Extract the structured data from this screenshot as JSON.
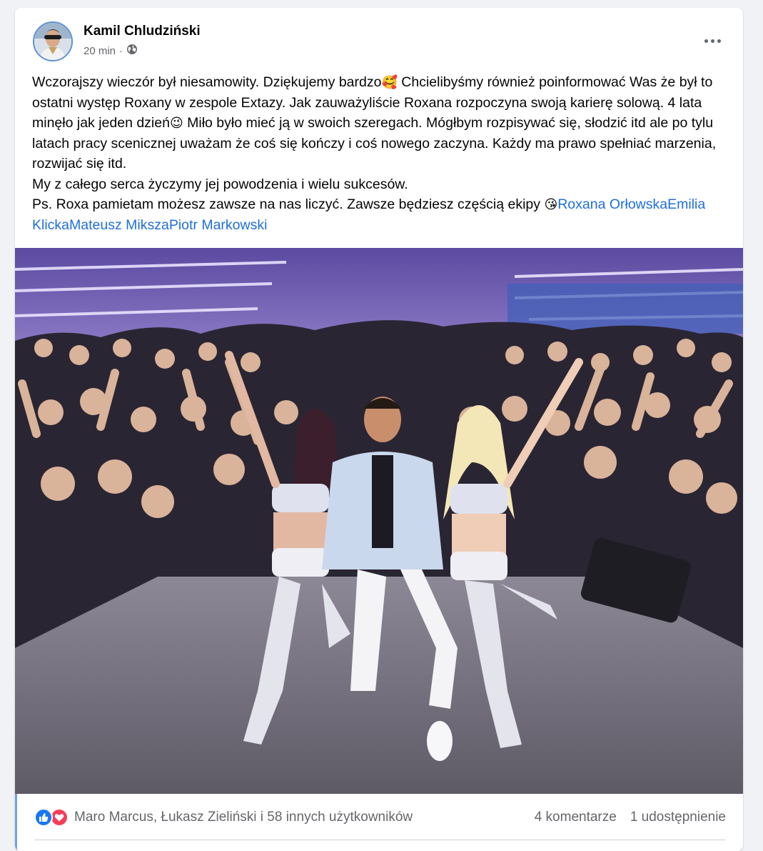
{
  "post": {
    "author": "Kamil Chludziński",
    "time": "20 min",
    "separator": "·",
    "audience_icon": "globe-icon",
    "more_icon": "more-dots-icon",
    "text": {
      "p1_a": "Wczorajszy wieczór był niesamowity. Dziękujemy bardzo",
      "emoji1": "🥰",
      "p1_b": " Chcielibyśmy również poinformować Was że był to ostatni występ Roxany w zespole Extazy. Jak zauważyliście Roxana rozpoczyna swoją karierę solową. 4 lata minęło jak jeden dzień",
      "emoji2": "😉",
      "p1_c": " Miło było mieć ją w swoich szeregach. Mógłbym rozpisywać się, słodzić itd ale po tylu latach pracy scenicznej uważam że coś się kończy i coś nowego zaczyna. Każdy ma prawo spełniać marzenia, rozwijać się itd.",
      "p2": "My z całego serca życzymy jej powodzenia i wielu sukcesów.",
      "p3": "Ps. Roxa pamietam możesz zawsze na nas liczyć. Zawsze będziesz częścią ekipy ",
      "emoji3": "😘",
      "mentions": [
        "Roxana Orłowska",
        "Emilia Klicka",
        "Mateusz Miksza",
        "Piotr Markowski"
      ]
    },
    "photo": {
      "alt": "group-photo",
      "colors": {
        "wall": "#b9a7e8",
        "stage": "#77737f",
        "crowd": "#2a2533",
        "light": "#e9e3ff"
      }
    }
  },
  "footer": {
    "reaction_icons": [
      "like-icon",
      "love-icon"
    ],
    "reactors": "Maro Marcus, Łukasz Zieliński i 58 innych użytkowników",
    "comments": "4 komentarze",
    "shares": "1 udostępnienie"
  },
  "colors": {
    "link": "#216fdb",
    "secondary_text": "#65676b",
    "like_blue": "#1877f2",
    "love_red": "#f33e58"
  }
}
